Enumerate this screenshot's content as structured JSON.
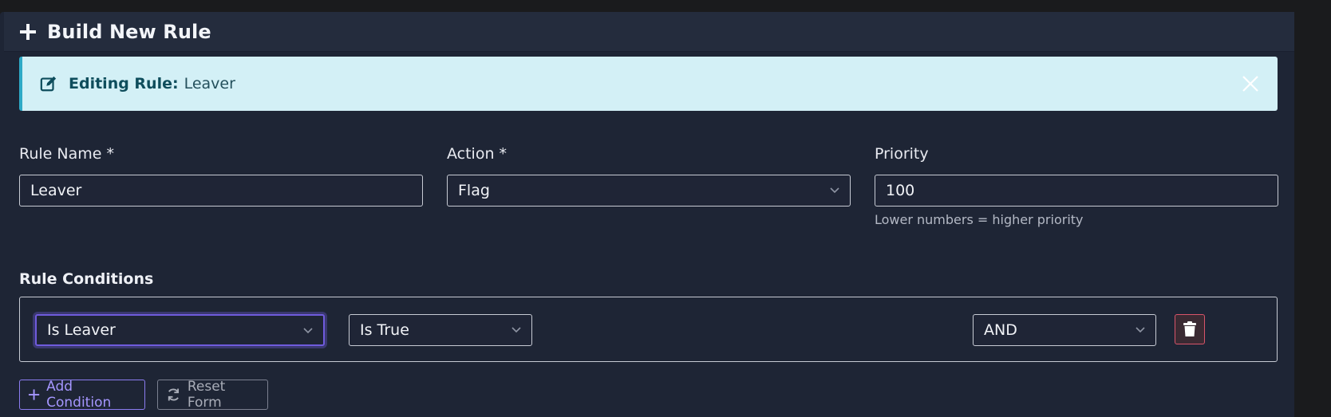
{
  "header": {
    "title": "Build New Rule",
    "icon": "plus-icon"
  },
  "alert": {
    "icon": "edit-icon",
    "strong": "Editing Rule:",
    "value": "Leaver",
    "close_icon": "close-icon",
    "background": "#d3f0f6",
    "accent": "#2ea9c6"
  },
  "form": {
    "rule_name": {
      "label": "Rule Name *",
      "value": "Leaver"
    },
    "action": {
      "label": "Action *",
      "value": "Flag"
    },
    "priority": {
      "label": "Priority",
      "value": "100",
      "help": "Lower numbers = higher priority"
    }
  },
  "conditions": {
    "label": "Rule Conditions",
    "rows": [
      {
        "field": "Is Leaver",
        "operator": "Is True",
        "logic": "AND"
      }
    ],
    "delete_icon": "trash-icon"
  },
  "buttons": {
    "add_condition": "Add Condition",
    "reset_form": "Reset Form"
  },
  "colors": {
    "card_bg": "#1e2535",
    "header_bg": "#242c3d",
    "primary_purple": "#8b7cf0",
    "danger": "#d9546a"
  }
}
